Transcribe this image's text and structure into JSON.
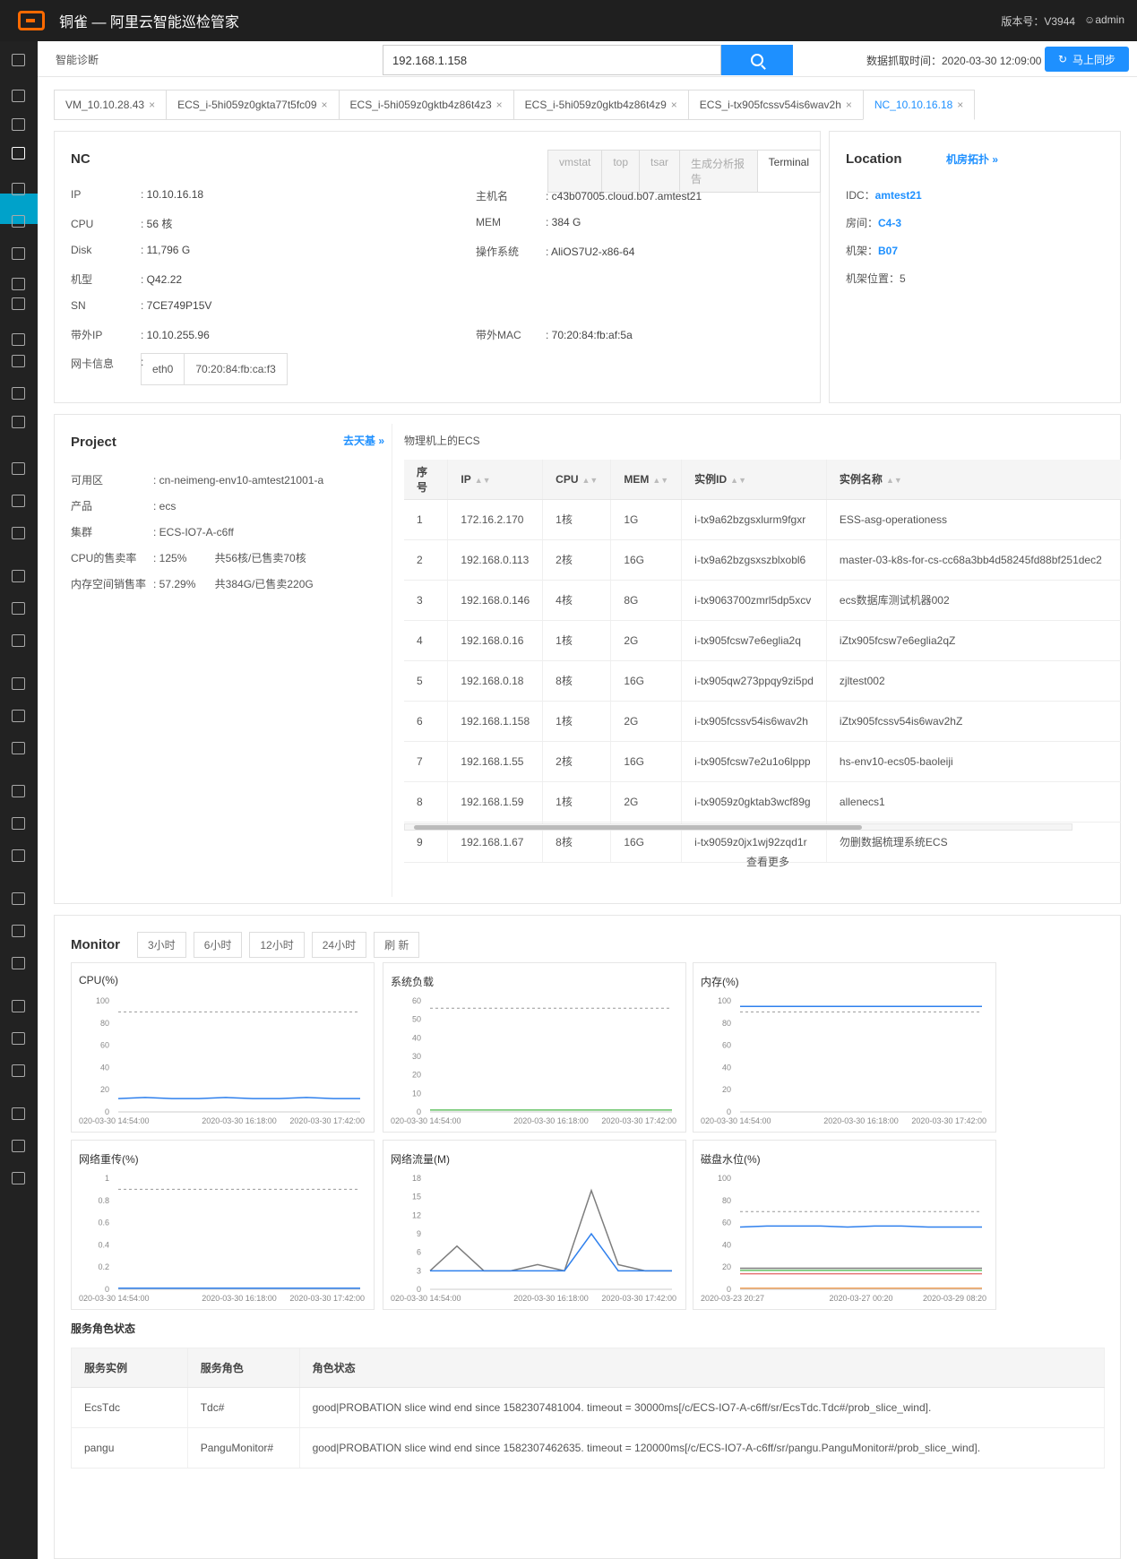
{
  "app": {
    "title": "铜雀 — 阿里云智能巡检管家",
    "version": "版本号：V3944",
    "user": "admin"
  },
  "header": {
    "crumb": "智能诊断",
    "search_value": "192.168.1.158",
    "fetch_time": "数据抓取时间：2020-03-30 12:09:00",
    "sync_label": "马上同步"
  },
  "tabs": [
    {
      "label": "VM_10.10.28.43"
    },
    {
      "label": "ECS_i-5hi059z0gkta77t5fc09"
    },
    {
      "label": "ECS_i-5hi059z0gktb4z86t4z3"
    },
    {
      "label": "ECS_i-5hi059z0gktb4z86t4z9"
    },
    {
      "label": "ECS_i-tx905fcssv54is6wav2h"
    },
    {
      "label": "NC_10.10.16.18",
      "active": true
    }
  ],
  "nc": {
    "title": "NC",
    "buttons": [
      "vmstat",
      "top",
      "tsar",
      "生成分析报告",
      "Terminal"
    ],
    "left": [
      {
        "k": "IP",
        "v": "10.10.16.18"
      },
      {
        "k": "CPU",
        "v": "56 核"
      },
      {
        "k": "Disk",
        "v": "11,796 G"
      },
      {
        "k": "机型",
        "v": "Q42.22"
      },
      {
        "k": "SN",
        "v": "7CE749P15V"
      },
      {
        "k": "带外IP",
        "v": "10.10.255.96"
      }
    ],
    "right": [
      {
        "k": "主机名",
        "v": "c43b07005.cloud.b07.amtest21"
      },
      {
        "k": "MEM",
        "v": "384 G"
      },
      {
        "k": "操作系统",
        "v": "AliOS7U2-x86-64"
      },
      {
        "k": "带外MAC",
        "v": "70:20:84:fb:af:5a"
      }
    ],
    "nic_label": "网卡信息",
    "nic_name": "eth0",
    "nic_mac": "70:20:84:fb:ca:f3"
  },
  "location": {
    "title": "Location",
    "link": "机房拓扑",
    "idc_k": "IDC：",
    "idc": "amtest21",
    "room_k": "房间：",
    "room": "C4-3",
    "rack_k": "机架：",
    "rack": "B07",
    "pos_k": "机架位置：",
    "pos": "5"
  },
  "project": {
    "title": "Project",
    "link": "去天基",
    "rows": [
      {
        "k": "可用区",
        "v": "cn-neimeng-env10-amtest21001-a",
        "extra": ""
      },
      {
        "k": "产品",
        "v": "ecs",
        "extra": ""
      },
      {
        "k": "集群",
        "v": "ECS-IO7-A-c6ff",
        "extra": ""
      },
      {
        "k": "CPU的售卖率",
        "v": "125%",
        "extra": "共56核/已售卖70核"
      },
      {
        "k": "内存空间销售率",
        "v": "57.29%",
        "extra": "共384G/已售卖220G"
      }
    ]
  },
  "ecs": {
    "title": "物理机上的ECS",
    "headers": [
      "序号",
      "IP",
      "CPU",
      "MEM",
      "实例ID",
      "实例名称"
    ],
    "rows": [
      [
        "1",
        "172.16.2.170",
        "1核",
        "1G",
        "i-tx9a62bzgsxlurm9fgxr",
        "ESS-asg-operationess"
      ],
      [
        "2",
        "192.168.0.113",
        "2核",
        "16G",
        "i-tx9a62bzgsxszblxobl6",
        "master-03-k8s-for-cs-cc68a3bb4d58245fd88bf251dec2"
      ],
      [
        "3",
        "192.168.0.146",
        "4核",
        "8G",
        "i-tx9063700zmrl5dp5xcv",
        "ecs数据库测试机器002"
      ],
      [
        "4",
        "192.168.0.16",
        "1核",
        "2G",
        "i-tx905fcsw7e6eglia2q",
        "iZtx905fcsw7e6eglia2qZ"
      ],
      [
        "5",
        "192.168.0.18",
        "8核",
        "16G",
        "i-tx905qw273ppqy9zi5pd",
        "zjltest002"
      ],
      [
        "6",
        "192.168.1.158",
        "1核",
        "2G",
        "i-tx905fcssv54is6wav2h",
        "iZtx905fcssv54is6wav2hZ"
      ],
      [
        "7",
        "192.168.1.55",
        "2核",
        "16G",
        "i-tx905fcsw7e2u1o6lppp",
        "hs-env10-ecs05-baoleiji"
      ],
      [
        "8",
        "192.168.1.59",
        "1核",
        "2G",
        "i-tx9059z0gktab3wcf89g",
        "allenecs1"
      ],
      [
        "9",
        "192.168.1.67",
        "8核",
        "16G",
        "i-tx9059z0jx1wj92zqd1r",
        "勿删数据梳理系统ECS"
      ]
    ],
    "more": "查看更多"
  },
  "monitor": {
    "title": "Monitor",
    "ranges": [
      "3小时",
      "6小时",
      "12小时",
      "24小时",
      "刷 新"
    ]
  },
  "charts": [
    {
      "title": "CPU(%)",
      "y": [
        "100",
        "80",
        "60",
        "40",
        "20",
        "0"
      ],
      "x": [
        "020-03-30 14:54:00",
        "2020-03-30 16:18:00",
        "2020-03-30 17:42:00"
      ]
    },
    {
      "title": "系统负载",
      "y": [
        "60",
        "50",
        "40",
        "30",
        "20",
        "10",
        "0"
      ],
      "x": [
        "020-03-30 14:54:00",
        "2020-03-30 16:18:00",
        "2020-03-30 17:42:00"
      ]
    },
    {
      "title": "内存(%)",
      "y": [
        "100",
        "80",
        "60",
        "40",
        "20",
        "0"
      ],
      "x": [
        "020-03-30 14:54:00",
        "2020-03-30 16:18:00",
        "2020-03-30 17:42:00"
      ]
    },
    {
      "title": "网络重传(%)",
      "y": [
        "1",
        "0.8",
        "0.6",
        "0.4",
        "0.2",
        "0"
      ],
      "x": [
        "020-03-30 14:54:00",
        "2020-03-30 16:18:00",
        "2020-03-30 17:42:00"
      ]
    },
    {
      "title": "网络流量(M)",
      "y": [
        "18",
        "15",
        "12",
        "9",
        "6",
        "3",
        "0"
      ],
      "x": [
        "020-03-30 14:54:00",
        "2020-03-30 16:18:00",
        "2020-03-30 17:42:00"
      ]
    },
    {
      "title": "磁盘水位(%)",
      "y": [
        "100",
        "80",
        "60",
        "40",
        "20",
        "0"
      ],
      "x": [
        "2020-03-23 20:27",
        "2020-03-27 00:20",
        "2020-03-29 08:20"
      ]
    }
  ],
  "chart_data": [
    {
      "type": "line",
      "title": "CPU(%)",
      "ylim": [
        0,
        100
      ],
      "series": [
        {
          "values": [
            12,
            13,
            12,
            12,
            13,
            12,
            12,
            13,
            12,
            12
          ]
        }
      ],
      "threshold": 90
    },
    {
      "type": "line",
      "title": "系统负载",
      "ylim": [
        0,
        60
      ],
      "series": [
        {
          "values": [
            1,
            1,
            1,
            1,
            1,
            1,
            1,
            1,
            1,
            1
          ]
        }
      ],
      "threshold": 56
    },
    {
      "type": "line",
      "title": "内存(%)",
      "ylim": [
        0,
        100
      ],
      "series": [
        {
          "values": [
            95,
            95,
            95,
            95,
            95,
            95,
            95,
            95,
            95,
            95
          ]
        }
      ],
      "threshold": 90
    },
    {
      "type": "line",
      "title": "网络重传(%)",
      "ylim": [
        0,
        1
      ],
      "series": [
        {
          "values": [
            0.01,
            0.01,
            0.01,
            0.01,
            0.01,
            0.01,
            0.01,
            0.01,
            0.01,
            0.01
          ]
        }
      ],
      "threshold": 0.9
    },
    {
      "type": "line",
      "title": "网络流量(M)",
      "ylim": [
        0,
        18
      ],
      "series": [
        {
          "values": [
            3,
            7,
            3,
            3,
            4,
            3,
            16,
            4,
            3,
            3
          ]
        },
        {
          "values": [
            3,
            3,
            3,
            3,
            3,
            3,
            9,
            3,
            3,
            3
          ]
        }
      ]
    },
    {
      "type": "line",
      "title": "磁盘水位(%)",
      "ylim": [
        0,
        100
      ],
      "series": [
        {
          "values": [
            56,
            57,
            57,
            57,
            56,
            57,
            57,
            56,
            56,
            56
          ]
        },
        {
          "values": [
            19,
            19,
            19,
            19,
            19,
            19,
            19,
            19,
            19,
            19
          ]
        },
        {
          "values": [
            17,
            17,
            17,
            17,
            17,
            17,
            17,
            17,
            17,
            17
          ]
        },
        {
          "values": [
            14,
            14,
            14,
            14,
            14,
            14,
            14,
            14,
            14,
            14
          ]
        },
        {
          "values": [
            1,
            1,
            1,
            1,
            1,
            1,
            1,
            1,
            1,
            1
          ]
        }
      ],
      "threshold": 70
    }
  ],
  "service": {
    "title": "服务角色状态",
    "headers": [
      "服务实例",
      "服务角色",
      "角色状态"
    ],
    "rows": [
      [
        "EcsTdc",
        "Tdc#",
        "good|PROBATION slice wind end since 1582307481004. timeout = 30000ms[/c/ECS-IO7-A-c6ff/sr/EcsTdc.Tdc#/prob_slice_wind]."
      ],
      [
        "pangu",
        "PanguMonitor#",
        "good|PROBATION slice wind end since 1582307462635. timeout = 120000ms[/c/ECS-IO7-A-c6ff/sr/pangu.PanguMonitor#/prob_slice_wind]."
      ]
    ]
  }
}
